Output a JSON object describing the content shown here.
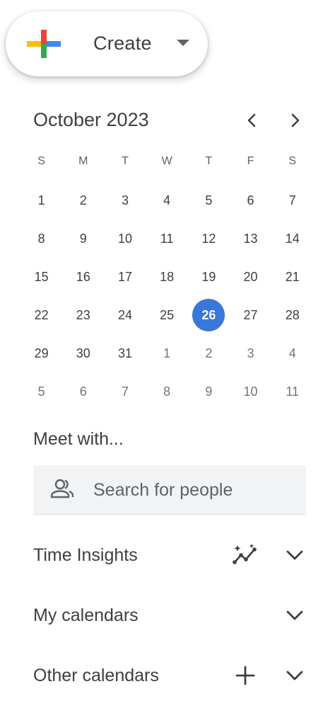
{
  "create": {
    "label": "Create"
  },
  "calendar": {
    "month_title": "October 2023",
    "weekdays": [
      "S",
      "M",
      "T",
      "W",
      "T",
      "F",
      "S"
    ],
    "weeks": [
      [
        "1",
        "2",
        "3",
        "4",
        "5",
        "6",
        "7"
      ],
      [
        "8",
        "9",
        "10",
        "11",
        "12",
        "13",
        "14"
      ],
      [
        "15",
        "16",
        "17",
        "18",
        "19",
        "20",
        "21"
      ],
      [
        "22",
        "23",
        "24",
        "25",
        "26",
        "27",
        "28"
      ],
      [
        "29",
        "30",
        "31",
        "1",
        "2",
        "3",
        "4"
      ],
      [
        "5",
        "6",
        "7",
        "8",
        "9",
        "10",
        "11"
      ]
    ],
    "today": "26",
    "today_color": "#3a78d8"
  },
  "meet": {
    "title": "Meet with...",
    "search_placeholder": "Search for people"
  },
  "sections": {
    "time_insights": "Time Insights",
    "my_calendars": "My calendars",
    "other_calendars": "Other calendars"
  },
  "icons": {
    "create": "google-plus-icon",
    "prev": "chevron-left-icon",
    "next": "chevron-right-icon",
    "people": "people-icon",
    "insights": "sparkle-chart-icon",
    "expand": "chevron-down-icon",
    "add": "plus-icon"
  },
  "colors": {
    "google_red": "#ea4335",
    "google_blue": "#4285f4",
    "google_yellow": "#fbbc04",
    "google_green": "#34a853"
  }
}
